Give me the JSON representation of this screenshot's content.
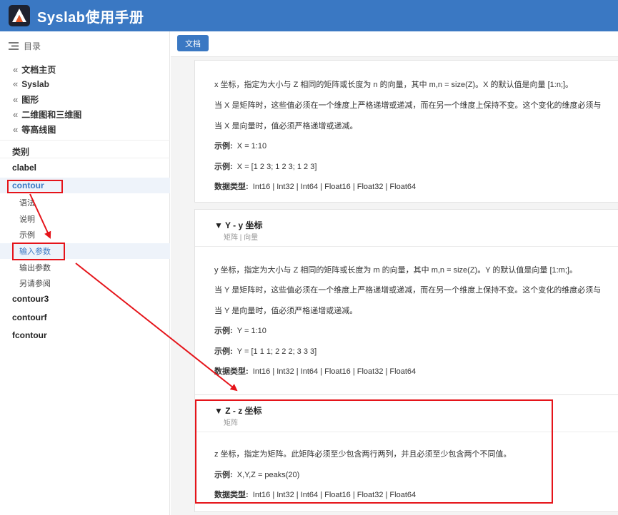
{
  "header": {
    "title": "Syslab使用手册"
  },
  "sidebar": {
    "toc_label": "目录",
    "breadcrumbs": [
      "文档主页",
      "Syslab",
      "图形",
      "二维图和三维图",
      "等高线图"
    ],
    "category_label": "类别",
    "items": [
      {
        "label": "clabel"
      },
      {
        "label": "contour",
        "subitems": [
          "语法",
          "说明",
          "示例",
          "输入参数",
          "输出参数",
          "另请参阅"
        ]
      },
      {
        "label": "contour3"
      },
      {
        "label": "contourf"
      },
      {
        "label": "fcontour"
      }
    ]
  },
  "tabs": {
    "doc_label": "文档"
  },
  "x_section": {
    "desc": "x 坐标，指定为大小与 Z 相同的矩阵或长度为 n 的向量，其中 m,n = size(Z)。X 的默认值是向量 [1:n;]。",
    "matrix_note": "当 X 是矩阵时，这些值必须在一个维度上严格递增或递减，而在另一个维度上保持不变。这个变化的维度必须与",
    "vector_note": "当 X 是向量时，值必须严格递增或递减。",
    "example_label": "示例:",
    "example1": "X = 1:10",
    "example2": "X = [1 2 3; 1 2 3; 1 2 3]",
    "dtype_label": "数据类型:",
    "dtypes": "Int16 | Int32 | Int64 | Float16 | Float32 | Float64"
  },
  "y_section": {
    "title": "▼ Y - y 坐标",
    "subtitle": "矩阵 | 向量",
    "desc": "y 坐标，指定为大小与 Z 相同的矩阵或长度为 m 的向量，其中 m,n = size(Z)。Y 的默认值是向量 [1:m;]。",
    "matrix_note": "当 Y 是矩阵时，这些值必须在一个维度上严格递增或递减，而在另一个维度上保持不变。这个变化的维度必须与",
    "vector_note": "当 Y 是向量时，值必须严格递增或递减。",
    "example_label": "示例:",
    "example1": "Y = 1:10",
    "example2": "Y = [1 1 1; 2 2 2; 3 3 3]",
    "dtype_label": "数据类型:",
    "dtypes": "Int16 | Int32 | Int64 | Float16 | Float32 | Float64"
  },
  "z_section": {
    "title": "▼ Z - z 坐标",
    "subtitle": "矩阵",
    "desc": "z 坐标，指定为矩阵。此矩阵必须至少包含两行两列，并且必须至少包含两个不同值。",
    "example_label": "示例:",
    "example1": "X,Y,Z = peaks(20)",
    "dtype_label": "数据类型:",
    "dtypes": "Int16 | Int32 | Int64 | Float16 | Float32 | Float64"
  },
  "colors": {
    "accent": "#3a78c3",
    "annotation": "#e5141a"
  }
}
